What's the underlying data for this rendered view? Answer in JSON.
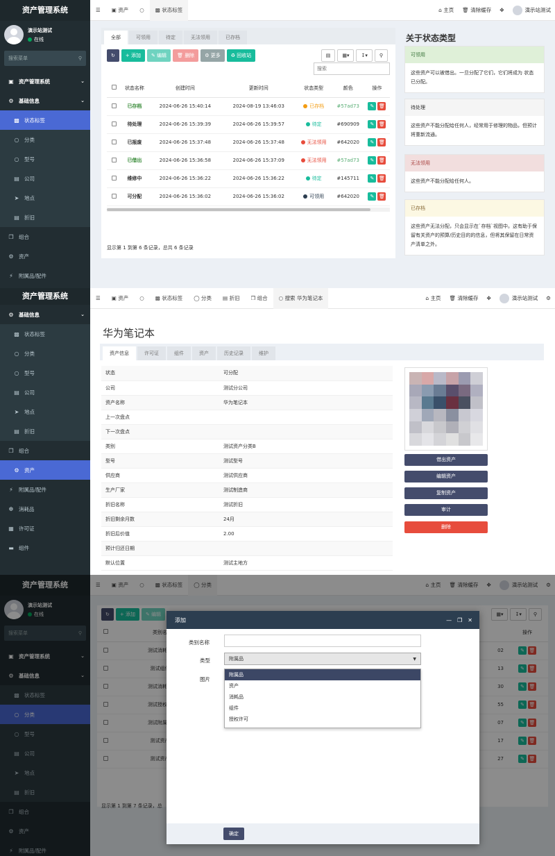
{
  "app_title": "资产管理系统",
  "user": {
    "name": "演示站测试",
    "status": "在线"
  },
  "search_menu_placeholder": "搜索菜单",
  "topbar_right": {
    "home": "主页",
    "clear_cache": "清除缓存",
    "user": "演示站测试"
  },
  "panel1": {
    "sidebar": [
      {
        "label": "资产管理系统",
        "icon": "cube-icon",
        "type": "hdr"
      },
      {
        "label": "基础信息",
        "icon": "gear-icon",
        "type": "hdr"
      },
      {
        "label": "状态标签",
        "icon": "tag-icon",
        "type": "active"
      },
      {
        "label": "分类",
        "icon": "circle-icon",
        "type": "sub"
      },
      {
        "label": "型号",
        "icon": "circle-icon",
        "type": "sub"
      },
      {
        "label": "公司",
        "icon": "building-icon",
        "type": "sub"
      },
      {
        "label": "地点",
        "icon": "location-icon",
        "type": "sub"
      },
      {
        "label": "折旧",
        "icon": "list-icon",
        "type": "sub"
      },
      {
        "label": "组合",
        "icon": "copy-icon",
        "type": "plain"
      },
      {
        "label": "资产",
        "icon": "gear-icon",
        "type": "plain"
      },
      {
        "label": "附属品/配件",
        "icon": "plug-icon",
        "type": "plain"
      }
    ],
    "tabs": [
      "资产",
      "状态标签"
    ],
    "filter_tabs": [
      "全部",
      "可领用",
      "待定",
      "无法领用",
      "已存档"
    ],
    "toolbar": {
      "add": "添加",
      "edit": "编辑",
      "delete": "删除",
      "more": "更多",
      "recycle": "回收站"
    },
    "search_placeholder": "搜索",
    "columns": [
      "状态名称",
      "创建时间",
      "更新时间",
      "状态类型",
      "颜色",
      "操作"
    ],
    "rows": [
      {
        "name": "已存档",
        "created": "2024-06-26 15:40:14",
        "updated": "2024-08-19 13:46:03",
        "type": "已存档",
        "type_color": "#f39c12",
        "color": "#57ad73",
        "name_color": "#3c8d3c"
      },
      {
        "name": "待处理",
        "created": "2024-06-26 15:39:39",
        "updated": "2024-06-26 15:39:57",
        "type": "待定",
        "type_color": "#18bc9c",
        "color": "#690909",
        "name_color": "#333"
      },
      {
        "name": "已报废",
        "created": "2024-06-26 15:37:48",
        "updated": "2024-06-26 15:37:48",
        "type": "无法领用",
        "type_color": "#e74c3c",
        "color": "#642020",
        "name_color": "#333"
      },
      {
        "name": "已借出",
        "created": "2024-06-26 15:36:58",
        "updated": "2024-06-26 15:37:09",
        "type": "无法领用",
        "type_color": "#e74c3c",
        "color": "#57ad73",
        "name_color": "#3c8d3c"
      },
      {
        "name": "维修中",
        "created": "2024-06-26 15:36:22",
        "updated": "2024-06-26 15:36:22",
        "type": "待定",
        "type_color": "#18bc9c",
        "color": "#145711",
        "name_color": "#333"
      },
      {
        "name": "可分配",
        "created": "2024-06-26 15:36:02",
        "updated": "2024-06-26 15:36:02",
        "type": "可领用",
        "type_color": "#2c3e50",
        "color": "#642020",
        "name_color": "#333"
      }
    ],
    "footer": "显示第 1 到第 6 条记录，总共 6 条记录",
    "about_title": "关于状态类型",
    "cards": [
      {
        "title": "可领用",
        "body": "这些资产可以被借出。一旦分配了它们，它们将成为 状态 已分配。",
        "bg": "#dff0d8",
        "fg": "#3c763d"
      },
      {
        "title": "待处理",
        "body": "这些资产不能分配给任何人，经常用于修理的物品，但预计将重新流通。",
        "bg": "#f5f5f5",
        "fg": "#333333"
      },
      {
        "title": "无法领用",
        "body": "这些资产不能分配给任何人。",
        "bg": "#f2dede",
        "fg": "#a94442"
      },
      {
        "title": "已存档",
        "body": "这些资产无法分配，只会显示在`存档`视图中。这有助于保留有关资产的预算/历史目的的信息，但将其保留在日常资产清单之外。",
        "bg": "#fcf8e3",
        "fg": "#8a6d3b"
      }
    ]
  },
  "panel2": {
    "sidebar": [
      {
        "label": "资产管理系统",
        "icon": "cube-icon",
        "type": "hdr"
      },
      {
        "label": "基础信息",
        "icon": "gear-icon",
        "type": "hdr"
      },
      {
        "label": "状态标签",
        "icon": "tag-icon",
        "type": "sub"
      },
      {
        "label": "分类",
        "icon": "circle-icon",
        "type": "sub"
      },
      {
        "label": "型号",
        "icon": "circle-icon",
        "type": "sub"
      },
      {
        "label": "公司",
        "icon": "building-icon",
        "type": "sub"
      },
      {
        "label": "地点",
        "icon": "location-icon",
        "type": "sub"
      },
      {
        "label": "折旧",
        "icon": "list-icon",
        "type": "sub"
      },
      {
        "label": "组合",
        "icon": "copy-icon",
        "type": "plain"
      },
      {
        "label": "资产",
        "icon": "gear-icon",
        "type": "active"
      },
      {
        "label": "附属品/配件",
        "icon": "plug-icon",
        "type": "plain"
      },
      {
        "label": "消耗品",
        "icon": "drop-icon",
        "type": "plain"
      },
      {
        "label": "许可证",
        "icon": "save-icon",
        "type": "plain"
      },
      {
        "label": "组件",
        "icon": "hdd-icon",
        "type": "plain"
      }
    ],
    "tabs": [
      "资产",
      "状态标签",
      "分类",
      "折旧",
      "组合",
      "搜索 华为笔记本"
    ],
    "page_title": "华为笔记本",
    "sub_tabs": [
      "资产信息",
      "许可证",
      "组件",
      "资产",
      "历史记录",
      "维护"
    ],
    "details": [
      [
        "状态",
        "可分配"
      ],
      [
        "公司",
        "测试分公司"
      ],
      [
        "资产名称",
        "华为笔记本"
      ],
      [
        "上一次盘点",
        ""
      ],
      [
        "下一次盘点",
        ""
      ],
      [
        "类别",
        "测试资产分类B"
      ],
      [
        "型号",
        "测试型号"
      ],
      [
        "供应商",
        "测试供应商"
      ],
      [
        "生产厂家",
        "测试制造商"
      ],
      [
        "折旧名称",
        "测试折旧"
      ],
      [
        "折旧剩余月数",
        "24月"
      ],
      [
        "折旧后价值",
        "2.00"
      ],
      [
        "预计归还日期",
        ""
      ],
      [
        "默认位置",
        "测试主地方"
      ]
    ],
    "buttons": {
      "checkout": "借出资产",
      "edit": "编辑资产",
      "copy": "复制资产",
      "audit": "审计",
      "delete": "删除"
    }
  },
  "panel3": {
    "sidebar": [
      {
        "label": "基础信息",
        "icon": "gear-icon",
        "type": "hdr"
      },
      {
        "label": "状态标签",
        "icon": "tag-icon",
        "type": "sub"
      },
      {
        "label": "分类",
        "icon": "circle-icon",
        "type": "active"
      },
      {
        "label": "型号",
        "icon": "circle-icon",
        "type": "sub"
      },
      {
        "label": "公司",
        "icon": "building-icon",
        "type": "sub"
      },
      {
        "label": "地点",
        "icon": "location-icon",
        "type": "sub"
      },
      {
        "label": "折旧",
        "icon": "list-icon",
        "type": "sub"
      },
      {
        "label": "组合",
        "icon": "copy-icon",
        "type": "plain"
      },
      {
        "label": "资产",
        "icon": "gear-icon",
        "type": "plain"
      },
      {
        "label": "附属品/配件",
        "icon": "plug-icon",
        "type": "plain"
      }
    ],
    "sidebar_top": {
      "label": "资产管理系统",
      "icon": "cube-icon"
    },
    "tabs": [
      "资产",
      "状态标签",
      "分类"
    ],
    "toolbar": {
      "add": "添加",
      "edit": "编辑"
    },
    "columns": [
      "类别名称",
      "操作"
    ],
    "rows": [
      {
        "name": "测试消耗品分",
        "tail": "02"
      },
      {
        "name": "测试组件分",
        "tail": "13"
      },
      {
        "name": "测试消耗品分",
        "tail": "30"
      },
      {
        "name": "测试授权许可",
        "tail": "55"
      },
      {
        "name": "测试附属品分",
        "tail": "07"
      },
      {
        "name": "测试资产分",
        "tail": "17"
      },
      {
        "name": "测试资产分",
        "tail": "27"
      }
    ],
    "footer": "显示第 1 到第 7 条记录，总",
    "modal": {
      "title": "添加",
      "field_name": "类别名称",
      "field_type": "类型",
      "field_image": "图片",
      "selected": "附属品",
      "options": [
        "附属品",
        "资产",
        "消耗品",
        "组件",
        "授权许可"
      ],
      "confirm": "确定"
    }
  }
}
